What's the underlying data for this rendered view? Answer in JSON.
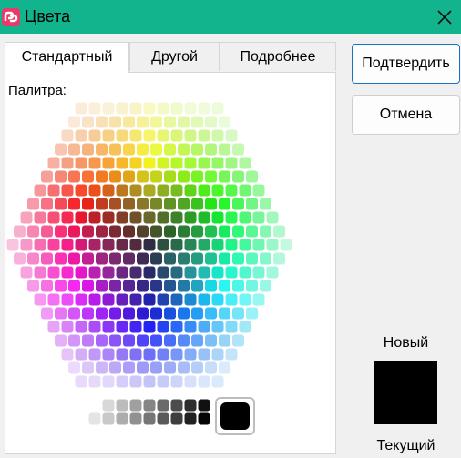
{
  "window": {
    "title": "Цвета",
    "icon": "app-logo-icon",
    "accent": "#12b48e"
  },
  "tabs": [
    {
      "label": "Стандартный",
      "active": true
    },
    {
      "label": "Другой",
      "active": false
    },
    {
      "label": "Подробнее",
      "active": false
    }
  ],
  "palette": {
    "label": "Палитра:"
  },
  "buttons": {
    "confirm": "Подтвердить",
    "cancel": "Отмена"
  },
  "preview": {
    "new_label": "Новый",
    "current_label": "Текущий",
    "new_color": "#000000",
    "current_color": "#000000"
  },
  "selected_color": "#000000"
}
